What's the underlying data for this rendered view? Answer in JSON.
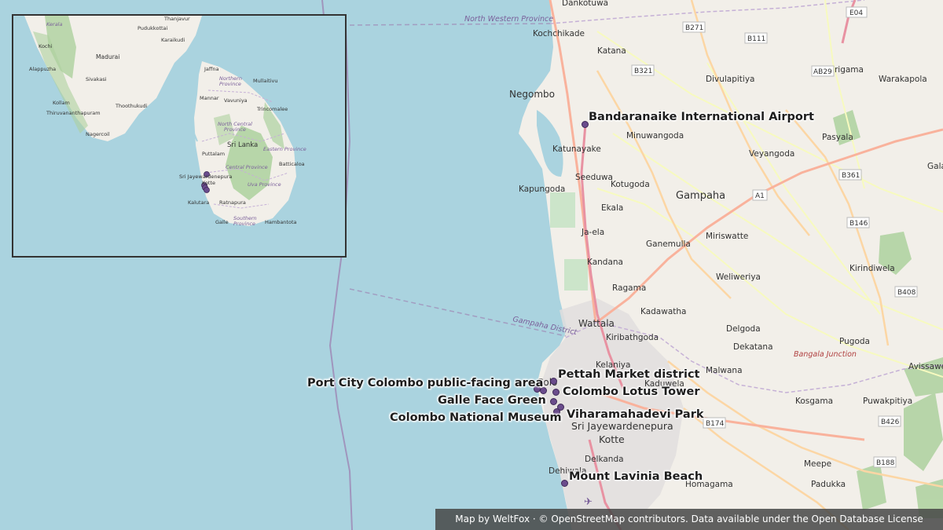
{
  "map": {
    "places": {
      "dankotuwa": "Dankotuwa",
      "kochchikade": "Kochchikade",
      "katana": "Katana",
      "mirigama": "Mirigama",
      "warakapola": "Warakapola",
      "negombo": "Negombo",
      "divulapitiya": "Divulapitiya",
      "minuwangoda": "Minuwangoda",
      "katunayake": "Katunayake",
      "pasyala": "Pasyala",
      "veyangoda": "Veyangoda",
      "seeduwa": "Seeduwa",
      "kotugoda": "Kotugoda",
      "kapungoda": "Kapungoda",
      "ekala": "Ekala",
      "gampaha": "Gampaha",
      "jaela": "Ja-ela",
      "miriswatte": "Miriswatte",
      "ganemulla": "Ganemulla",
      "kandana": "Kandana",
      "weliweriya": "Weliweriya",
      "kirindiwela": "Kirindiwela",
      "ragama": "Ragama",
      "kadawatha": "Kadawatha",
      "wattala": "Wattala",
      "delgoda": "Delgoda",
      "kiribathgoda": "Kiribathgoda",
      "pugoda": "Pugoda",
      "dekatana": "Dekatana",
      "kelaniya": "Kelaniya",
      "kaduwela": "Kaduwela",
      "malwana": "Malwana",
      "avissawella": "Avissawe",
      "kosgama": "Kosgama",
      "puwakpitiya": "Puwakpitiya",
      "sjp": "Sri Jayewardenepura",
      "kotte": "Kotte",
      "delkanda": "Delkanda",
      "meepe": "Meepe",
      "dehiwala": "Dehiwala",
      "padukka": "Padukka",
      "homagama": "Homagama",
      "galap": "Gala"
    },
    "roads": {
      "e04": "E04",
      "b271": "B271",
      "b111": "B111",
      "b321": "B321",
      "ab29": "AB29",
      "a1": "A1",
      "b361": "B361",
      "b146": "B146",
      "b408": "B408",
      "b174": "B174",
      "b426": "B426",
      "b188": "B188"
    },
    "regions": {
      "nw_province": "North Western Province",
      "gampaha_district": "Gampaha District",
      "bangala_junction": "Bangala Junction"
    },
    "colombo_fragment": "Colo"
  },
  "inset": {
    "places": {
      "thanjavur": "Thanjavur",
      "kerala": "Kerala",
      "pudukkottai": "Pudukkottai",
      "karaikudi": "Karaikudi",
      "kochi": "Kochi",
      "madurai": "Madurai",
      "alappuzha": "Alappuzha",
      "sivakasi": "Sivakasi",
      "jaffna": "Jaffna",
      "northern": "Northern",
      "province1": "Province",
      "mullaitivu": "Mullaitivu",
      "mannar": "Mannar",
      "vavuniya": "Vavuniya",
      "kollam": "Kollam",
      "thoothukudi": "Thoothukudi",
      "thiruvananthapuram": "Thiruvananthapuram",
      "trincomalee": "Trincomalee",
      "north_central": "North Central",
      "province2": "Province",
      "nagercoil": "Nagercoil",
      "sri_lanka": "Sri Lanka",
      "eastern_province": "Eastern Province",
      "puttalam": "Puttalam",
      "central_province": "Central Province",
      "batticaloa": "Batticaloa",
      "sjp": "Sri Jayewardenepura",
      "kotte": "Kotte",
      "uva_province": "Uva Province",
      "kalutara": "Kalutara",
      "ratnapura": "Ratnapura",
      "southern": "Southern",
      "province3": "Province",
      "galle": "Galle",
      "hambantota": "Hambantota"
    }
  },
  "pois": [
    {
      "name": "Bandaranaike International Airport"
    },
    {
      "name": "Pettah Market district"
    },
    {
      "name": "Port City Colombo public-facing area"
    },
    {
      "name": "Colombo Lotus Tower"
    },
    {
      "name": "Galle Face Green"
    },
    {
      "name": "Viharamahadevi Park"
    },
    {
      "name": "Colombo National Museum"
    },
    {
      "name": "Mount Lavinia Beach"
    }
  ],
  "colors": {
    "sea": "#aad3df",
    "land": "#f2efe9",
    "marker": "#6a4c8c",
    "motorway": "#e892a2",
    "trunk": "#f9b29c",
    "forest": "#add19e"
  },
  "attribution": "Map by WeltFox · © OpenStreetMap contributors. Data available under the Open Database License"
}
